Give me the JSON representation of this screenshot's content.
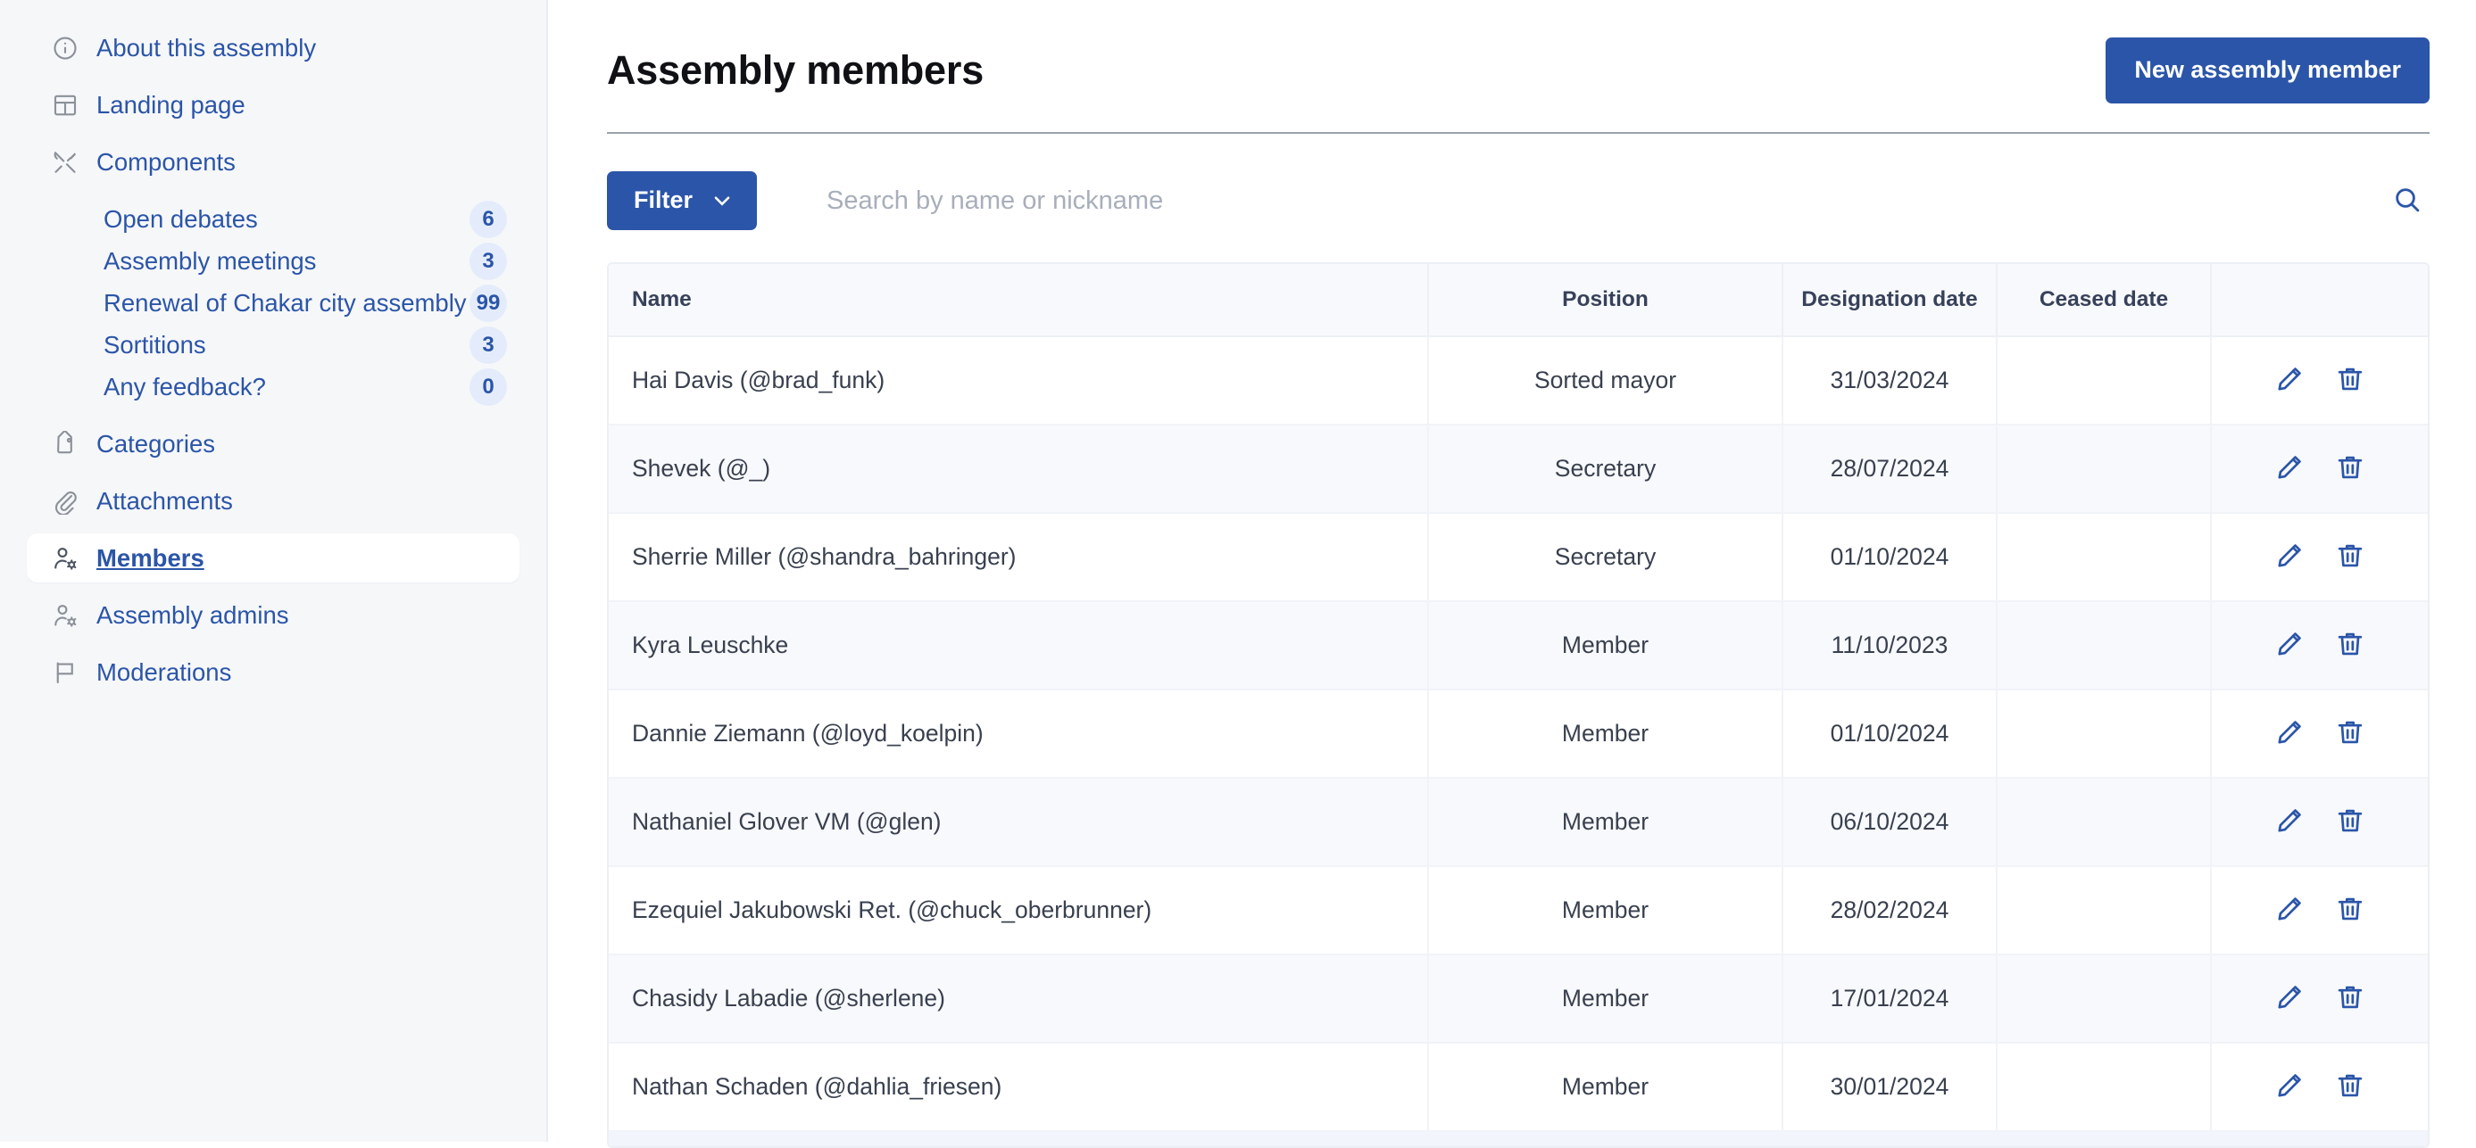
{
  "sidebar": {
    "items": [
      {
        "label": "About this assembly",
        "icon": "info-circle-icon",
        "active": false
      },
      {
        "label": "Landing page",
        "icon": "layout-grid-icon",
        "active": false
      },
      {
        "label": "Components",
        "icon": "tools-icon",
        "active": false
      },
      {
        "label": "Categories",
        "icon": "tag-icon",
        "active": false
      },
      {
        "label": "Attachments",
        "icon": "paperclip-icon",
        "active": false
      },
      {
        "label": "Members",
        "icon": "user-settings-icon",
        "active": true
      },
      {
        "label": "Assembly admins",
        "icon": "user-settings-icon",
        "active": false
      },
      {
        "label": "Moderations",
        "icon": "flag-icon",
        "active": false
      }
    ],
    "components": [
      {
        "label": "Open debates",
        "count": "6"
      },
      {
        "label": "Assembly meetings",
        "count": "3"
      },
      {
        "label": "Renewal of Chakar city assembly",
        "count": "99"
      },
      {
        "label": "Sortitions",
        "count": "3"
      },
      {
        "label": "Any feedback?",
        "count": "0"
      }
    ]
  },
  "header": {
    "title": "Assembly members",
    "new_button_label": "New assembly member"
  },
  "toolbar": {
    "filter_label": "Filter",
    "search_placeholder": "Search by name or nickname",
    "search_value": ""
  },
  "table": {
    "columns": [
      "Name",
      "Position",
      "Designation date",
      "Ceased date",
      ""
    ],
    "rows": [
      {
        "name": "Hai Davis (@brad_funk)",
        "position": "Sorted mayor",
        "designation_date": "31/03/2024",
        "ceased_date": ""
      },
      {
        "name": "Shevek (@_)",
        "position": "Secretary",
        "designation_date": "28/07/2024",
        "ceased_date": ""
      },
      {
        "name": "Sherrie Miller (@shandra_bahringer)",
        "position": "Secretary",
        "designation_date": "01/10/2024",
        "ceased_date": ""
      },
      {
        "name": "Kyra Leuschke",
        "position": "Member",
        "designation_date": "11/10/2023",
        "ceased_date": ""
      },
      {
        "name": "Dannie Ziemann (@loyd_koelpin)",
        "position": "Member",
        "designation_date": "01/10/2024",
        "ceased_date": ""
      },
      {
        "name": "Nathaniel Glover VM (@glen)",
        "position": "Member",
        "designation_date": "06/10/2024",
        "ceased_date": ""
      },
      {
        "name": "Ezequiel Jakubowski Ret. (@chuck_oberbrunner)",
        "position": "Member",
        "designation_date": "28/02/2024",
        "ceased_date": ""
      },
      {
        "name": "Chasidy Labadie (@sherlene)",
        "position": "Member",
        "designation_date": "17/01/2024",
        "ceased_date": ""
      },
      {
        "name": "Nathan Schaden (@dahlia_friesen)",
        "position": "Member",
        "designation_date": "30/01/2024",
        "ceased_date": ""
      }
    ]
  },
  "colors": {
    "accent": "#2b55a8",
    "link": "#2b55a8",
    "badge_bg": "#e4ecfb",
    "sidebar_bg": "#f6f7f9",
    "row_alt_bg": "#f8f9fc",
    "text": "#39404f"
  }
}
